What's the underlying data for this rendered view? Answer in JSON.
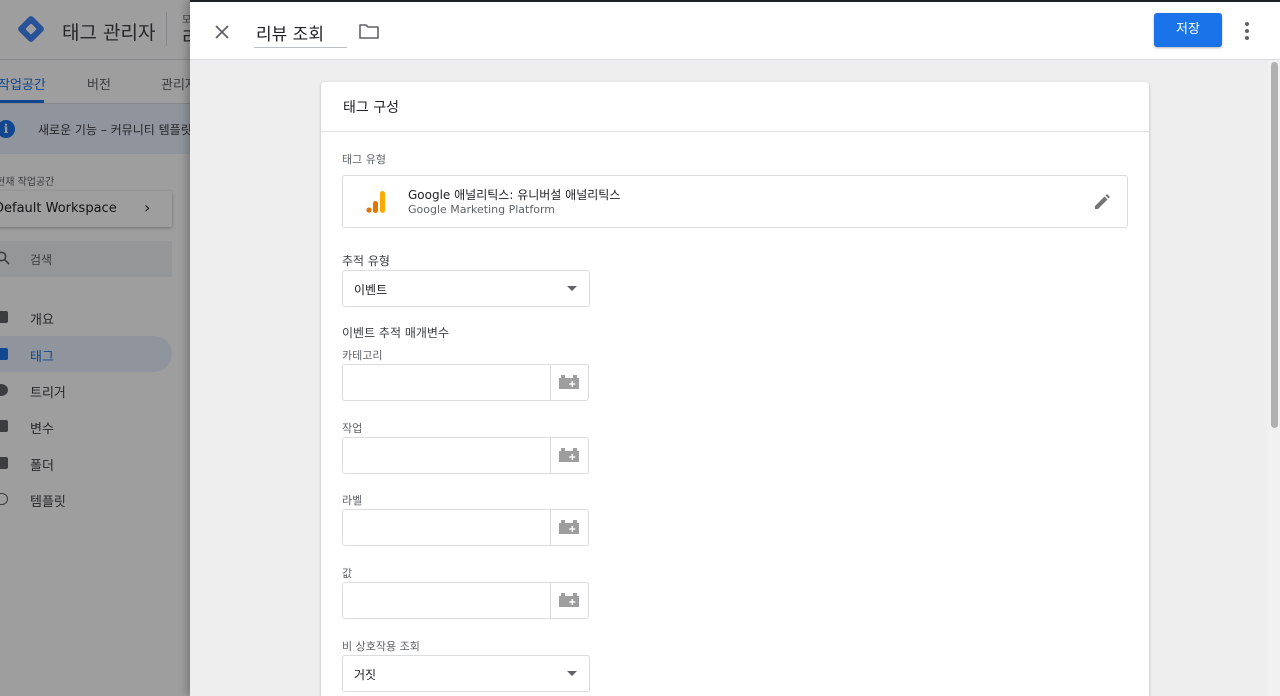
{
  "background_app": {
    "title": "태그 관리자",
    "account_small": "모",
    "account_name": "리",
    "tabs": [
      {
        "label": "작업공간",
        "active": true
      },
      {
        "label": "버전",
        "active": false
      },
      {
        "label": "관리자",
        "active": false
      }
    ],
    "banner_icon": "i",
    "banner_text": "새로운 기능 – 커뮤니티 템플릿 갤",
    "workspace_section_label": "현재 작업공간",
    "workspace_name": "Default Workspace",
    "search_label": "검색",
    "nav": [
      {
        "label": "개요",
        "icon": "overview-icon",
        "active": false
      },
      {
        "label": "태그",
        "icon": "tag-icon",
        "active": true
      },
      {
        "label": "트리거",
        "icon": "trigger-icon",
        "active": false
      },
      {
        "label": "변수",
        "icon": "variable-icon",
        "active": false
      },
      {
        "label": "폴더",
        "icon": "folder-icon",
        "active": false
      },
      {
        "label": "템플릿",
        "icon": "template-icon",
        "active": false
      }
    ]
  },
  "sheet": {
    "tag_name": "리뷰 조회",
    "save_label": "저장",
    "icons": {
      "close": "close-icon",
      "folder": "folder-icon",
      "more": "more-vert-icon"
    }
  },
  "card": {
    "title": "태그 구성",
    "tag_type_label": "태그 유형",
    "tag_type_name": "Google 애널리틱스: 유니버설 애널리틱스",
    "tag_type_vendor": "Google Marketing Platform",
    "track_type_label": "추적 유형",
    "track_type_value": "이벤트",
    "event_params_label": "이벤트 추적 매개변수",
    "fields": [
      {
        "label": "카테고리",
        "value": ""
      },
      {
        "label": "작업",
        "value": ""
      },
      {
        "label": "라벨",
        "value": ""
      },
      {
        "label": "값",
        "value": ""
      }
    ],
    "non_interaction_label": "비 상호작용 조회",
    "non_interaction_value": "거짓"
  },
  "colors": {
    "accent": "#1a73e8",
    "ga_orange_dark": "#e37400",
    "ga_orange_light": "#f9ab00"
  }
}
